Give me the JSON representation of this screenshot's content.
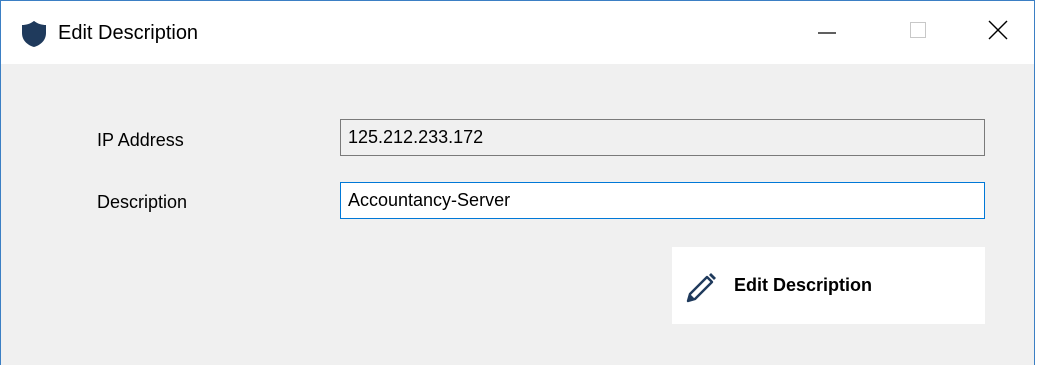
{
  "window": {
    "title": "Edit Description",
    "icon": "shield-icon",
    "controls": {
      "minimize": "minimize-icon",
      "maximize": "maximize-icon",
      "close": "close-icon"
    }
  },
  "form": {
    "ip_label": "IP Address",
    "ip_value": "125.212.233.172",
    "description_label": "Description",
    "description_value": "Accountancy-Server"
  },
  "action": {
    "button_label": "Edit Description",
    "icon": "pencil-icon",
    "icon_color": "#1f3a5c"
  },
  "colors": {
    "accent": "#0078d7",
    "window_border": "#3b7fc4",
    "background": "#f0f0f0"
  }
}
